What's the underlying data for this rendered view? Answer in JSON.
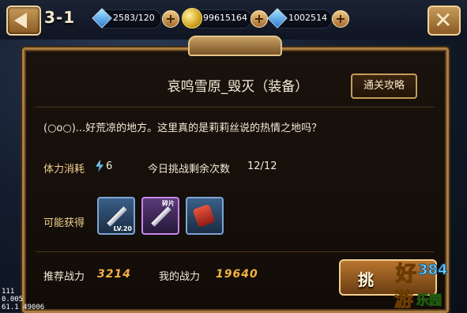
{
  "header": {
    "stage": "3-1",
    "gems": "2583/120",
    "gold": "99615164",
    "crystals": "1002514"
  },
  "panel": {
    "title": "哀鸣雪原_毁灭（装备）",
    "guide_button": "通关攻略",
    "description": "(○o○)...好荒凉的地方。这里真的是莉莉丝说的热情之地吗？",
    "stamina_label": "体力消耗",
    "stamina_value": "6",
    "attempts_label": "今日挑战剩余次数",
    "attempts_value": "12/12",
    "drops_label": "可能获得",
    "drops": [
      {
        "name": "sword",
        "badge": "LV.20"
      },
      {
        "name": "dark-sword",
        "badge": "碎片"
      },
      {
        "name": "scroll",
        "badge": ""
      }
    ],
    "recommended_label": "推荐战力",
    "recommended_value": "3214",
    "my_power_label": "我的战力",
    "my_power_value": "19640",
    "challenge_button": "挑"
  },
  "debug": {
    "line1": "111",
    "line2": "0.005",
    "line3": "61.1 49006"
  }
}
